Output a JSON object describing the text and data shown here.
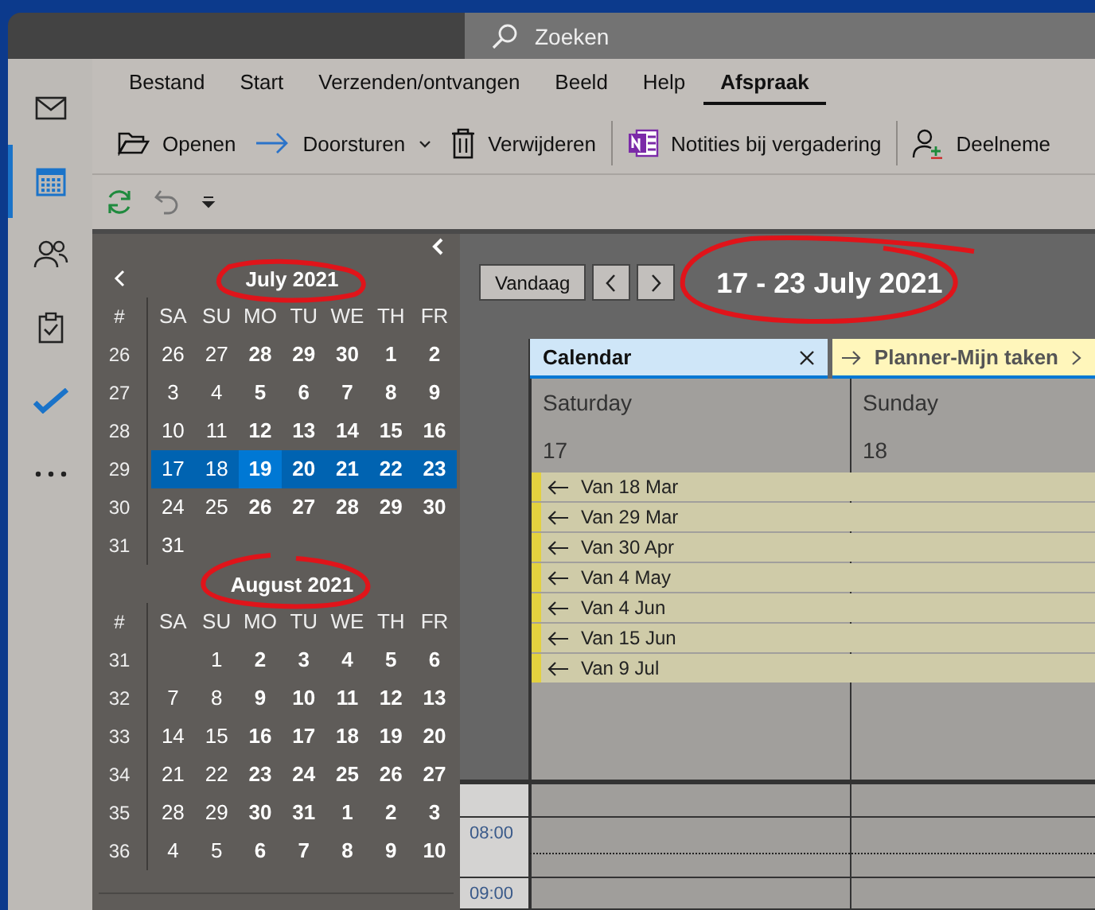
{
  "search": {
    "placeholder": "Zoeken"
  },
  "nav_items": [
    {
      "selected": false
    },
    {
      "selected": true
    },
    {
      "selected": false
    },
    {
      "selected": false
    },
    {
      "selected": false
    },
    {
      "selected": false
    }
  ],
  "ribbon_tabs": [
    {
      "label": "Bestand",
      "selected": false
    },
    {
      "label": "Start",
      "selected": false
    },
    {
      "label": "Verzenden/ontvangen",
      "selected": false
    },
    {
      "label": "Beeld",
      "selected": false
    },
    {
      "label": "Help",
      "selected": false
    },
    {
      "label": "Afspraak",
      "selected": true
    }
  ],
  "commands": [
    {
      "label": "Openen",
      "dropdown": false
    },
    {
      "label": "Doorsturen",
      "dropdown": true
    },
    {
      "label": "Verwijderen",
      "dropdown": false
    },
    {
      "label": "Notities bij vergadering",
      "dropdown": false
    },
    {
      "label": "Deelneme",
      "dropdown": false
    }
  ],
  "months": [
    {
      "title": "July 2021",
      "weekdays": [
        "#",
        "SA",
        "SU",
        "MO",
        "TU",
        "WE",
        "TH",
        "FR"
      ],
      "weeks": [
        {
          "week": "26",
          "selected": false,
          "days": [
            {
              "day": "26",
              "today": false
            },
            {
              "day": "27",
              "today": false
            },
            {
              "day": "28",
              "today": false
            },
            {
              "day": "29",
              "today": false
            },
            {
              "day": "30",
              "today": false
            },
            {
              "day": "1",
              "today": false
            },
            {
              "day": "2",
              "today": false
            }
          ]
        },
        {
          "week": "27",
          "selected": false,
          "days": [
            {
              "day": "3",
              "today": false
            },
            {
              "day": "4",
              "today": false
            },
            {
              "day": "5",
              "today": false
            },
            {
              "day": "6",
              "today": false
            },
            {
              "day": "7",
              "today": false
            },
            {
              "day": "8",
              "today": false
            },
            {
              "day": "9",
              "today": false
            }
          ]
        },
        {
          "week": "28",
          "selected": false,
          "days": [
            {
              "day": "10",
              "today": false
            },
            {
              "day": "11",
              "today": false
            },
            {
              "day": "12",
              "today": false
            },
            {
              "day": "13",
              "today": false
            },
            {
              "day": "14",
              "today": false
            },
            {
              "day": "15",
              "today": false
            },
            {
              "day": "16",
              "today": false
            }
          ]
        },
        {
          "week": "29",
          "selected": true,
          "days": [
            {
              "day": "17",
              "today": false
            },
            {
              "day": "18",
              "today": false
            },
            {
              "day": "19",
              "today": true
            },
            {
              "day": "20",
              "today": false
            },
            {
              "day": "21",
              "today": false
            },
            {
              "day": "22",
              "today": false
            },
            {
              "day": "23",
              "today": false
            }
          ]
        },
        {
          "week": "30",
          "selected": false,
          "days": [
            {
              "day": "24",
              "today": false
            },
            {
              "day": "25",
              "today": false
            },
            {
              "day": "26",
              "today": false
            },
            {
              "day": "27",
              "today": false
            },
            {
              "day": "28",
              "today": false
            },
            {
              "day": "29",
              "today": false
            },
            {
              "day": "30",
              "today": false
            }
          ]
        },
        {
          "week": "31",
          "selected": false,
          "days": [
            {
              "day": "31",
              "today": false
            }
          ]
        }
      ]
    },
    {
      "title": "August 2021",
      "weekdays": [
        "#",
        "SA",
        "SU",
        "MO",
        "TU",
        "WE",
        "TH",
        "FR"
      ],
      "weeks": [
        {
          "week": "31",
          "selected": false,
          "days": [
            {
              "day": "1",
              "today": false
            },
            {
              "day": "2",
              "today": false
            },
            {
              "day": "3",
              "today": false
            },
            {
              "day": "4",
              "today": false
            },
            {
              "day": "5",
              "today": false
            },
            {
              "day": "6",
              "today": false
            }
          ]
        },
        {
          "week": "32",
          "selected": false,
          "days": [
            {
              "day": "7",
              "today": false
            },
            {
              "day": "8",
              "today": false
            },
            {
              "day": "9",
              "today": false
            },
            {
              "day": "10",
              "today": false
            },
            {
              "day": "11",
              "today": false
            },
            {
              "day": "12",
              "today": false
            },
            {
              "day": "13",
              "today": false
            }
          ]
        },
        {
          "week": "33",
          "selected": false,
          "days": [
            {
              "day": "14",
              "today": false
            },
            {
              "day": "15",
              "today": false
            },
            {
              "day": "16",
              "today": false
            },
            {
              "day": "17",
              "today": false
            },
            {
              "day": "18",
              "today": false
            },
            {
              "day": "19",
              "today": false
            },
            {
              "day": "20",
              "today": false
            }
          ]
        },
        {
          "week": "34",
          "selected": false,
          "days": [
            {
              "day": "21",
              "today": false
            },
            {
              "day": "22",
              "today": false
            },
            {
              "day": "23",
              "today": false
            },
            {
              "day": "24",
              "today": false
            },
            {
              "day": "25",
              "today": false
            },
            {
              "day": "26",
              "today": false
            },
            {
              "day": "27",
              "today": false
            }
          ]
        },
        {
          "week": "35",
          "selected": false,
          "days": [
            {
              "day": "28",
              "today": false
            },
            {
              "day": "29",
              "today": false
            },
            {
              "day": "30",
              "today": false
            },
            {
              "day": "31",
              "today": false
            },
            {
              "day": "1",
              "today": false
            },
            {
              "day": "2",
              "today": false
            },
            {
              "day": "3",
              "today": false
            }
          ]
        },
        {
          "week": "36",
          "selected": false,
          "days": [
            {
              "day": "4",
              "today": false
            },
            {
              "day": "5",
              "today": false
            },
            {
              "day": "6",
              "today": false
            },
            {
              "day": "7",
              "today": false
            },
            {
              "day": "8",
              "today": false
            },
            {
              "day": "9",
              "today": false
            },
            {
              "day": "10",
              "today": false
            }
          ]
        }
      ]
    }
  ],
  "today_button": "Vandaag",
  "period_title": "17 - 23 July 2021",
  "calendar_tabs": [
    {
      "label": "Calendar",
      "kind": "calendar"
    },
    {
      "label": "Planner-Mijn taken",
      "kind": "planner"
    }
  ],
  "days": [
    {
      "name": "Saturday",
      "date": "17"
    },
    {
      "name": "Sunday",
      "date": "18"
    }
  ],
  "events": [
    "Van 18 Mar",
    "Van 29 Mar",
    "Van 30 Apr",
    "Van 4 May",
    "Van 4 Jun",
    "Van 15 Jun",
    "Van 9 Jul"
  ],
  "times": [
    "08:00",
    "09:00"
  ]
}
